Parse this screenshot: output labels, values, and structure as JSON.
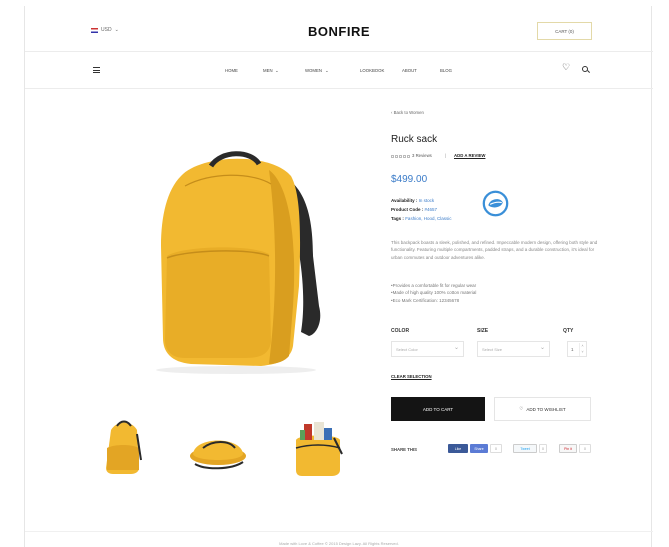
{
  "header": {
    "currency": "USD",
    "logo": "BONFIRE",
    "cart_label": "CART (0)"
  },
  "nav": {
    "items": [
      "HOME",
      "MEN",
      "WOMEN",
      "LOOKBOOK",
      "ABOUT",
      "BLOG"
    ],
    "dropdown_items": [
      "MEN",
      "WOMEN"
    ]
  },
  "product": {
    "breadcrumb": "‹ Back to Women",
    "title": "Ruck sack",
    "reviews_count": "3 Reviews",
    "separator": "|",
    "add_review_label": "ADD A REVIEW",
    "price": "$499.00",
    "availability_label": "Availability :",
    "availability_value": "In stock",
    "code_label": "Product Code :",
    "code_value": "#4657",
    "tags_label": "Tags :",
    "tags_value": "Fashion, Hood, Classic",
    "description": "This backpack boasts a sleek, polished, and refined. Impeccable modern design, offering both style and functionality. Featuring multiple compartments, padded straps, and a durable construction, it's ideal for urban commutes and outdoor adventures alike.",
    "bullets": [
      "Provides a comfortable fit for regular wear",
      "Made of high quality 100% cotton material",
      "Eco Mark Certification: 12345678"
    ]
  },
  "options": {
    "color_label": "COLOR",
    "size_label": "SIZE",
    "qty_label": "QTY",
    "color_placeholder": "Select Color",
    "size_placeholder": "Select Size",
    "qty_value": "1",
    "clear_label": "CLEAR SELECTION"
  },
  "actions": {
    "add_to_cart": "ADD TO CART",
    "wishlist": "ADD TO WISHLIST"
  },
  "share": {
    "label": "SHARE THIS",
    "buttons": [
      "Like",
      "Share",
      "0",
      "Tweet",
      "0",
      "Pin it",
      "0"
    ]
  },
  "footer": {
    "text": "Made with Love & Coffee © 2015 Design Lazy. All Rights Reserved."
  },
  "colors": {
    "accent_blue": "#3a7bc8",
    "backpack_yellow": "#f2b931",
    "button_dark": "#141414",
    "facebook": "#3b5998"
  }
}
